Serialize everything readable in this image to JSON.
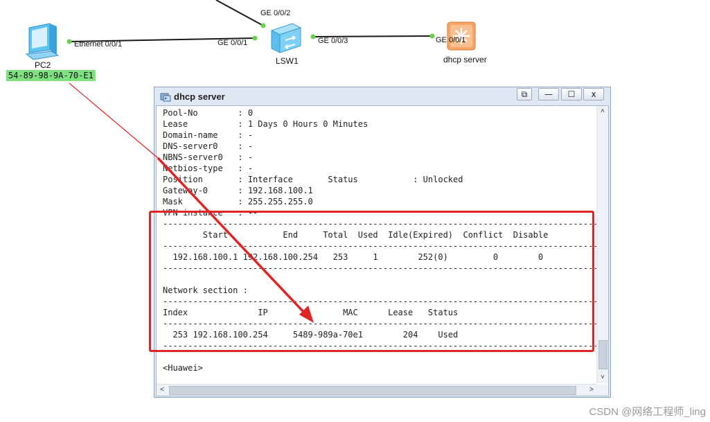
{
  "topology": {
    "pc": {
      "name": "PC2",
      "mac_label": "54-89-98-9A-70-E1",
      "port": "Ethernet 0/0/1"
    },
    "switch": {
      "name": "LSW1",
      "ports": {
        "to_pc": "GE 0/0/1",
        "uplink": "GE 0/0/2",
        "to_server": "GE 0/0/3"
      }
    },
    "server": {
      "name": "dhcp server",
      "port": "GE 0/0/1"
    },
    "link_color": "#1a1a1a",
    "port_dot_color": "#69d04d"
  },
  "window": {
    "title": "dhcp server",
    "restore_glyph": "⧉",
    "minimize_glyph": "—",
    "maximize_glyph": "☐",
    "close_glyph": "x"
  },
  "console": {
    "lines": [
      "Pool-No        : 0",
      "Lease          : 1 Days 0 Hours 0 Minutes",
      "Domain-name    : -",
      "DNS-server0    : -",
      "NBNS-server0   : -",
      "Netbios-type   : -",
      "Position       : Interface       Status           : Unlocked",
      "Gateway-0      : 192.168.100.1",
      "Mask           : 255.255.255.0",
      "VPN instance   : --",
      "----------------------------------------------------------------------------------------",
      "        Start           End     Total  Used  Idle(Expired)  Conflict  Disable",
      "----------------------------------------------------------------------------------------",
      "  192.168.100.1 192.168.100.254   253     1        252(0)         0        0",
      "----------------------------------------------------------------------------------------",
      "",
      "Network section :",
      "-----------------------------------------------------------------------------------------",
      "Index              IP               MAC      Lease   Status",
      "-----------------------------------------------------------------------------------------",
      "  253 192.168.100.254     5489-989a-70e1        204    Used",
      "-----------------------------------------------------------------------------------------",
      "",
      "<Huawei>"
    ]
  },
  "scroll": {
    "up": "˄",
    "down": "˅",
    "left": "<",
    "right": ">"
  },
  "annotation": {
    "color": "#e02424"
  },
  "watermark": "CSDN @网络工程师_ling"
}
